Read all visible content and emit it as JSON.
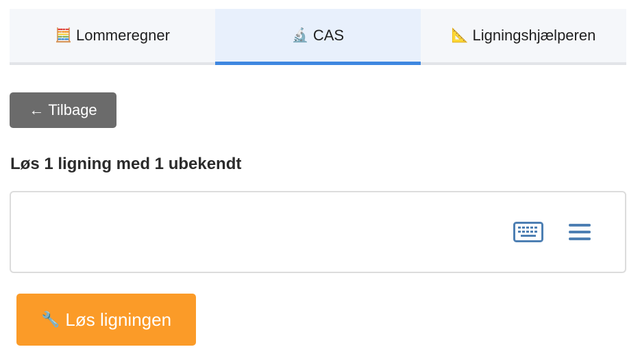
{
  "tabs": [
    {
      "label": "Lommeregner",
      "icon": "abacus-icon",
      "glyph": "🧮",
      "active": false
    },
    {
      "label": "CAS",
      "icon": "microscope-icon",
      "glyph": "🔬",
      "active": true
    },
    {
      "label": "Ligningshjælperen",
      "icon": "triangular-ruler-icon",
      "glyph": "📐",
      "active": false
    }
  ],
  "back_button": {
    "arrow": "←",
    "label": "Tilbage"
  },
  "heading": "Løs 1 ligning med 1 ubekendt",
  "math_field": {
    "value": "",
    "keyboard_icon": "keyboard-icon",
    "menu_icon": "hamburger-menu-icon"
  },
  "solve_button": {
    "icon": "wrench-icon",
    "glyph": "🔧",
    "label": "Løs ligningen"
  },
  "colors": {
    "accent": "#3e87e0",
    "back_button": "#6b6b6b",
    "solve_button": "#fb9b28",
    "icon": "#4d7fb3"
  }
}
